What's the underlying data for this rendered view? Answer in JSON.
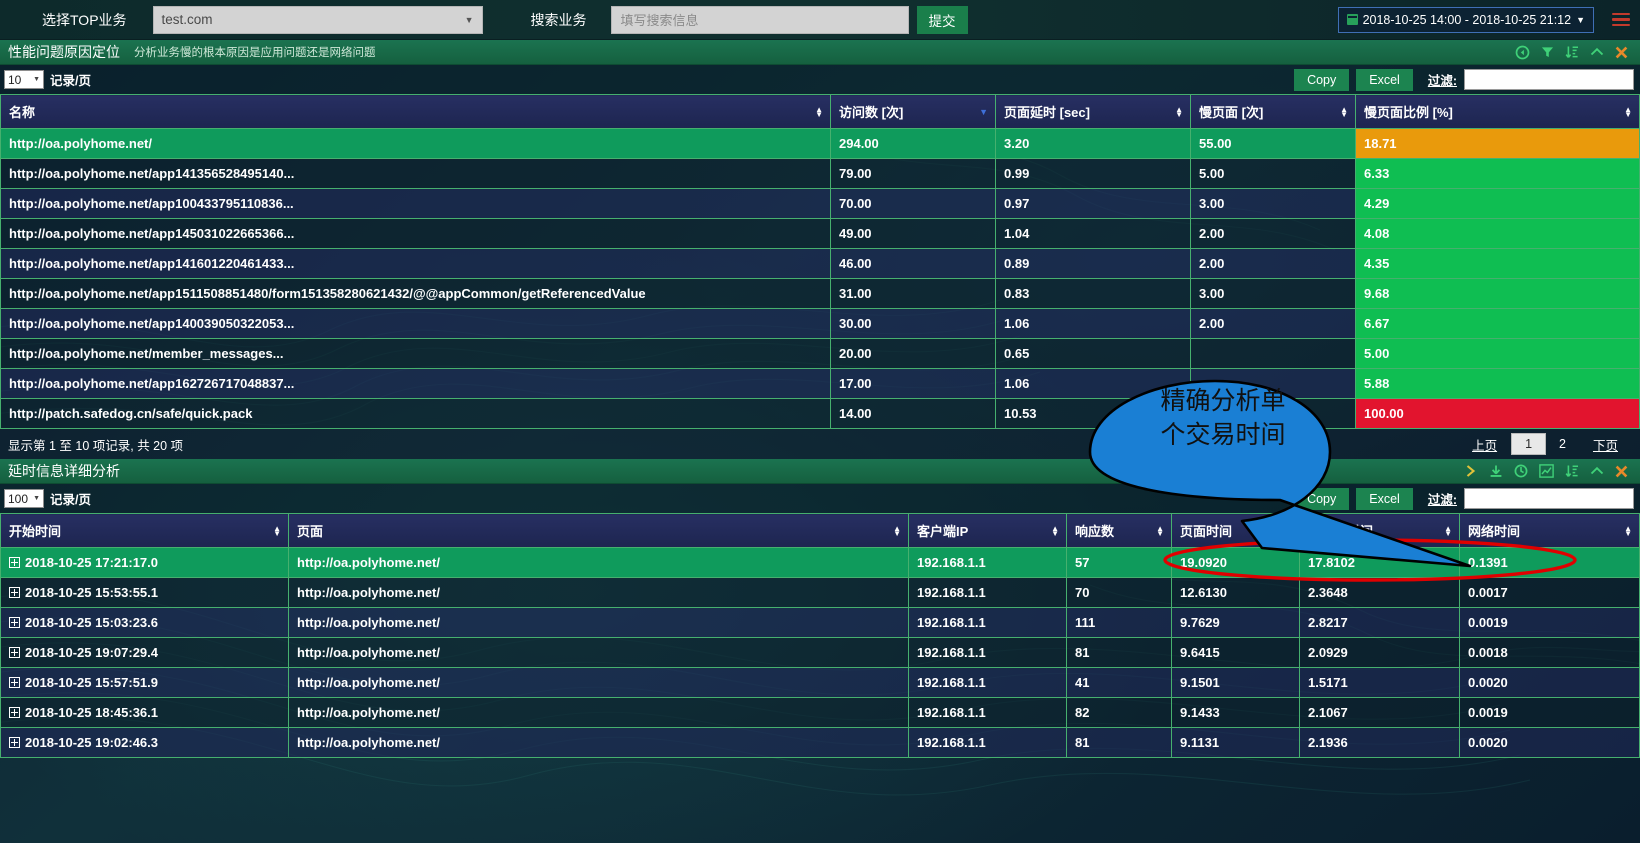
{
  "topbar": {
    "select_top_label": "选择TOP业务",
    "business_select_value": "test.com",
    "search_label": "搜索业务",
    "search_placeholder": "填写搜索信息",
    "submit_label": "提交",
    "date_range": "2018-10-25 14:00 - 2018-10-25 21:12",
    "calendar_icon": "calendar-icon",
    "caret_icon": "▾",
    "menu_icon": "hamburger-menu-icon"
  },
  "panel1": {
    "title": "性能问题原因定位",
    "subtitle": "分析业务慢的根本原因是应用问题还是网络问题",
    "icons": [
      "refresh-icon",
      "filter-icon",
      "sort-icon",
      "collapse-icon",
      "close-icon"
    ],
    "page_len": "10",
    "page_len_label": "记录/页",
    "copy_label": "Copy",
    "excel_label": "Excel",
    "filter_label": "过滤:",
    "filter_value": "",
    "columns": [
      "名称",
      "访问数 [次]",
      "页面延时 [sec]",
      "慢页面 [次]",
      "慢页面比例 [%]"
    ],
    "sorted_column_index": 1,
    "rows": [
      {
        "name": "http://oa.polyhome.net/",
        "visits": "294.00",
        "latency": "3.20",
        "slow": "55.00",
        "ratio": "18.71",
        "ratio_color": "orange",
        "highlight": true
      },
      {
        "name": "http://oa.polyhome.net/app141356528495140...",
        "visits": "79.00",
        "latency": "0.99",
        "slow": "5.00",
        "ratio": "6.33",
        "ratio_color": "green",
        "highlight": false
      },
      {
        "name": "http://oa.polyhome.net/app100433795110836...",
        "visits": "70.00",
        "latency": "0.97",
        "slow": "3.00",
        "ratio": "4.29",
        "ratio_color": "green",
        "highlight": false
      },
      {
        "name": "http://oa.polyhome.net/app145031022665366...",
        "visits": "49.00",
        "latency": "1.04",
        "slow": "2.00",
        "ratio": "4.08",
        "ratio_color": "green",
        "highlight": false
      },
      {
        "name": "http://oa.polyhome.net/app141601220461433...",
        "visits": "46.00",
        "latency": "0.89",
        "slow": "2.00",
        "ratio": "4.35",
        "ratio_color": "green",
        "highlight": false
      },
      {
        "name": "http://oa.polyhome.net/app1511508851480/form151358280621432/@@appCommon/getReferencedValue",
        "visits": "31.00",
        "latency": "0.83",
        "slow": "3.00",
        "ratio": "9.68",
        "ratio_color": "green",
        "highlight": false
      },
      {
        "name": "http://oa.polyhome.net/app140039050322053...",
        "visits": "30.00",
        "latency": "1.06",
        "slow": "2.00",
        "ratio": "6.67",
        "ratio_color": "green",
        "highlight": false
      },
      {
        "name": "http://oa.polyhome.net/member_messages...",
        "visits": "20.00",
        "latency": "0.65",
        "slow": "",
        "ratio": "5.00",
        "ratio_color": "green",
        "highlight": false
      },
      {
        "name": "http://oa.polyhome.net/app162726717048837...",
        "visits": "17.00",
        "latency": "1.06",
        "slow": "",
        "ratio": "5.88",
        "ratio_color": "green",
        "highlight": false
      },
      {
        "name": "http://patch.safedog.cn/safe/quick.pack",
        "visits": "14.00",
        "latency": "10.53",
        "slow": "",
        "ratio": "100.00",
        "ratio_color": "red",
        "highlight": false
      }
    ],
    "info": "显示第 1 至 10 项记录, 共 20 项",
    "pager": {
      "prev": "上页",
      "pages": [
        "1",
        "2"
      ],
      "active": "1",
      "next": "下页"
    }
  },
  "panel2": {
    "title": "延时信息详细分析",
    "icons": [
      "expand-arrow-icon",
      "download-icon",
      "target-icon",
      "chart-icon",
      "sort-icon",
      "collapse-icon",
      "close-icon"
    ],
    "page_len": "100",
    "page_len_label": "记录/页",
    "copy_label": "Copy",
    "excel_label": "Excel",
    "filter_label": "过滤:",
    "filter_value": "",
    "columns": [
      "开始时间",
      "页面",
      "客户端IP",
      "响应数",
      "页面时间",
      "服务器时间",
      "网络时间"
    ],
    "sorted_column_index": 4,
    "rows": [
      {
        "start": "2018-10-25 17:21:17.0",
        "page": "http://oa.polyhome.net/",
        "ip": "192.168.1.1",
        "resp": "57",
        "page_time": "19.0920",
        "server_time": "17.8102",
        "net_time": "0.1391",
        "highlight": true
      },
      {
        "start": "2018-10-25 15:53:55.1",
        "page": "http://oa.polyhome.net/",
        "ip": "192.168.1.1",
        "resp": "70",
        "page_time": "12.6130",
        "server_time": "2.3648",
        "net_time": "0.0017",
        "highlight": false
      },
      {
        "start": "2018-10-25 15:03:23.6",
        "page": "http://oa.polyhome.net/",
        "ip": "192.168.1.1",
        "resp": "111",
        "page_time": "9.7629",
        "server_time": "2.8217",
        "net_time": "0.0019",
        "highlight": false
      },
      {
        "start": "2018-10-25 19:07:29.4",
        "page": "http://oa.polyhome.net/",
        "ip": "192.168.1.1",
        "resp": "81",
        "page_time": "9.6415",
        "server_time": "2.0929",
        "net_time": "0.0018",
        "highlight": false
      },
      {
        "start": "2018-10-25 15:57:51.9",
        "page": "http://oa.polyhome.net/",
        "ip": "192.168.1.1",
        "resp": "41",
        "page_time": "9.1501",
        "server_time": "1.5171",
        "net_time": "0.0020",
        "highlight": false
      },
      {
        "start": "2018-10-25 18:45:36.1",
        "page": "http://oa.polyhome.net/",
        "ip": "192.168.1.1",
        "resp": "82",
        "page_time": "9.1433",
        "server_time": "2.1067",
        "net_time": "0.0019",
        "highlight": false
      },
      {
        "start": "2018-10-25 19:02:46.3",
        "page": "http://oa.polyhome.net/",
        "ip": "192.168.1.1",
        "resp": "81",
        "page_time": "9.1131",
        "server_time": "2.1936",
        "net_time": "0.0020",
        "highlight": false
      }
    ]
  },
  "annotations": {
    "callout_line1": "精确分析单",
    "callout_line2": "个交易时间",
    "callout_fill": "#1a7fd4",
    "oval_stroke": "#e00000"
  }
}
